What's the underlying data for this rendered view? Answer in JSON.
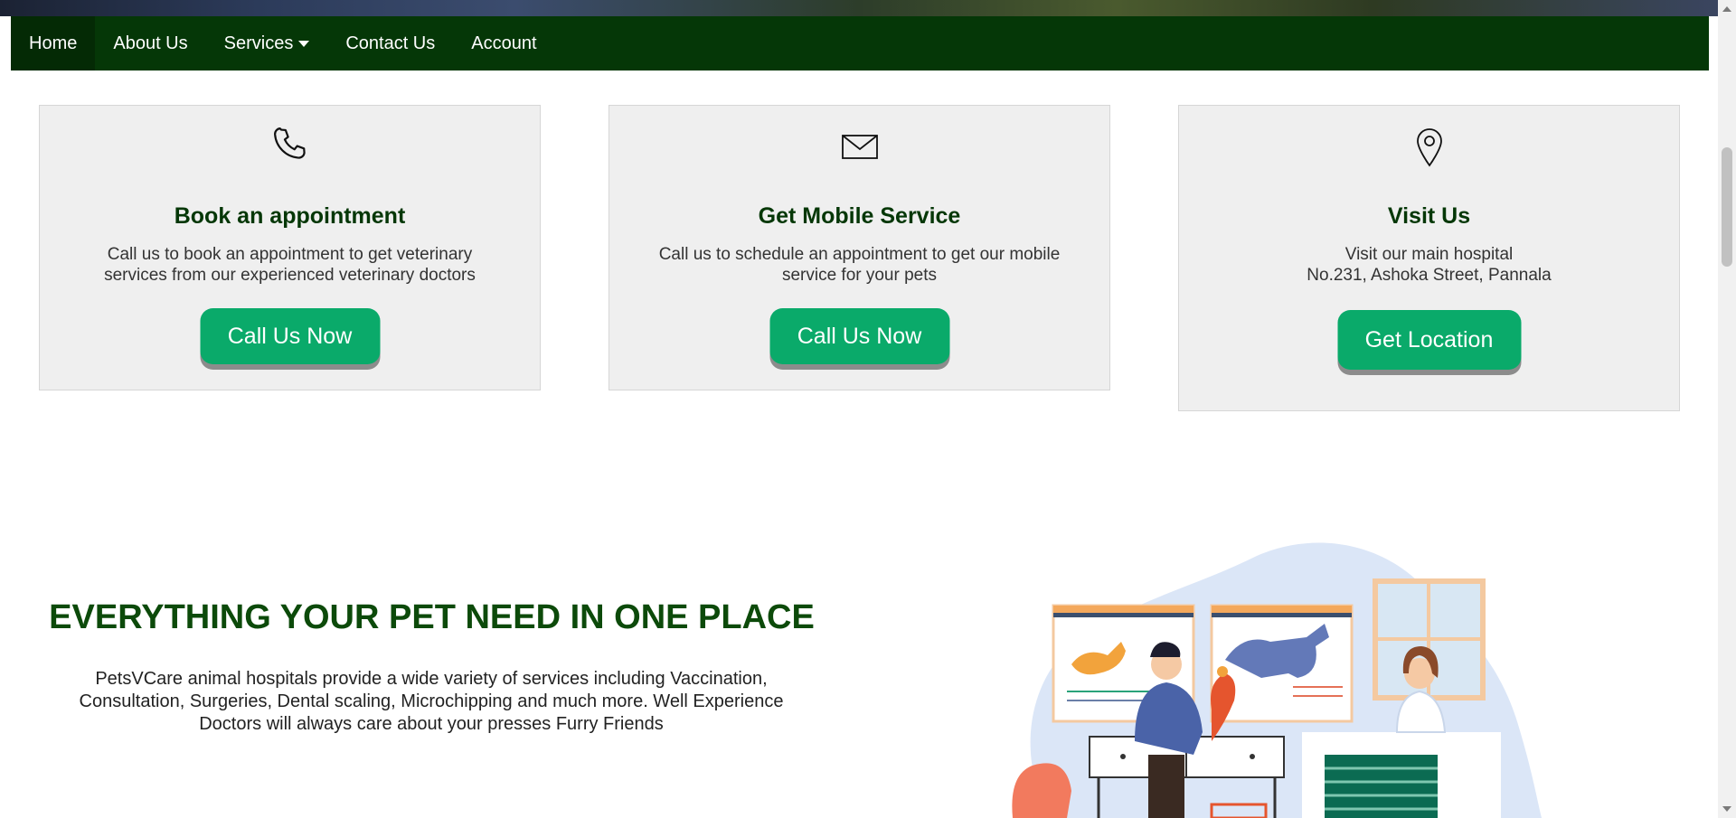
{
  "nav": {
    "items": [
      {
        "label": "Home"
      },
      {
        "label": "About Us"
      },
      {
        "label": "Services"
      },
      {
        "label": "Contact Us"
      },
      {
        "label": "Account"
      }
    ]
  },
  "cards": [
    {
      "icon": "phone-icon",
      "title": "Book an appointment",
      "text": "Call us to book an appointment to get veterinary services from our experienced veterinary doctors",
      "button": "Call Us Now"
    },
    {
      "icon": "envelope-icon",
      "title": "Get Mobile Service",
      "text": "Call us to schedule an appointment to get our mobile service for your pets",
      "button": "Call Us Now"
    },
    {
      "icon": "location-pin-icon",
      "title": "Visit Us",
      "text_line1": "Visit our main hospital",
      "text_line2": "No.231, Ashoka Street, Pannala",
      "button": "Get Location"
    }
  ],
  "promo": {
    "headline": "EVERYTHING YOUR PET NEED IN ONE PLACE",
    "description": "PetsVCare animal hospitals provide a wide variety of services including Vaccination, Consultation, Surgeries, Dental scaling, Microchipping and much more. Well Experience Doctors will always care about your presses Furry Friends"
  },
  "colors": {
    "nav_bg": "#053707",
    "button": "#0aaa6a",
    "heading": "#053707",
    "card_bg": "#efefef"
  }
}
